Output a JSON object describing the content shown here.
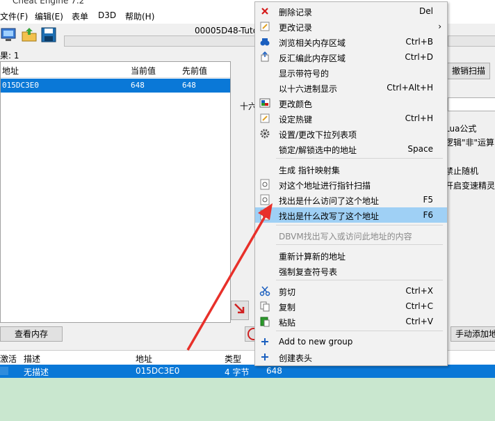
{
  "window": {
    "title": "Cheat Engine 7.2",
    "process": "00005D48-Tuto"
  },
  "menubar": [
    "文件(F)",
    "编辑(E)",
    "表单",
    "D3D",
    "帮助(H)"
  ],
  "scan_panel": {
    "found_label": "果: 1",
    "columns": [
      "地址",
      "当前值",
      "先前值"
    ],
    "rows": [
      {
        "address": "015DC3E0",
        "current": "648",
        "previous": "648"
      }
    ],
    "view_memory_button": "查看内存",
    "undo_scan_button": "撤销扫描",
    "hex_label": "十六",
    "lua_label": "Lua公式",
    "not_logic_label": "逻辑\"非\"运算",
    "no_random_label": "禁止随机",
    "speedhack_label": "开启变速精灵",
    "add_manual_button": "手动添加地"
  },
  "address_table": {
    "columns": [
      "激活",
      "描述",
      "地址",
      "类型",
      "数值"
    ],
    "rows": [
      {
        "active": "",
        "description": "无描述",
        "address": "015DC3E0",
        "type": "4 字节",
        "value": "648"
      }
    ]
  },
  "context_menu": {
    "items": [
      {
        "label": "删除记录",
        "shortcut": "Del",
        "icon": "delete-x-icon"
      },
      {
        "label": "更改记录",
        "shortcut": "",
        "icon": "edit-icon",
        "submenu": "›"
      },
      {
        "label": "浏览相关内存区域",
        "shortcut": "Ctrl+B",
        "icon": "binoculars-icon"
      },
      {
        "label": "反汇编此内存区域",
        "shortcut": "Ctrl+D",
        "icon": "disassemble-icon"
      },
      {
        "label": "显示带符号的",
        "shortcut": "",
        "icon": ""
      },
      {
        "label": "以十六进制显示",
        "shortcut": "Ctrl+Alt+H",
        "icon": ""
      },
      {
        "label": "更改颜色",
        "shortcut": "",
        "icon": "color-icon"
      },
      {
        "label": "设定热键",
        "shortcut": "Ctrl+H",
        "icon": "hotkey-icon"
      },
      {
        "label": "设置/更改下拉列表项",
        "shortcut": "",
        "icon": "gear-icon"
      },
      {
        "label": "锁定/解锁选中的地址",
        "shortcut": "Space",
        "icon": ""
      },
      {
        "label": "生成 指针映射集",
        "shortcut": "",
        "icon": ""
      },
      {
        "label": "对这个地址进行指针扫描",
        "shortcut": "",
        "icon": "pointer-scan-icon"
      },
      {
        "label": "找出是什么访问了这个地址",
        "shortcut": "F5",
        "icon": "find-access-icon"
      },
      {
        "label": "找出是什么改写了这个地址",
        "shortcut": "F6",
        "icon": "find-write-icon"
      },
      {
        "label": "DBVM找出写入或访问此地址的内容",
        "shortcut": "",
        "icon": ""
      },
      {
        "label": "重新计算新的地址",
        "shortcut": "",
        "icon": ""
      },
      {
        "label": "强制复查符号表",
        "shortcut": "",
        "icon": ""
      },
      {
        "label": "剪切",
        "shortcut": "Ctrl+X",
        "icon": "scissors-icon"
      },
      {
        "label": "复制",
        "shortcut": "Ctrl+C",
        "icon": "copy-icon"
      },
      {
        "label": "粘贴",
        "shortcut": "Ctrl+V",
        "icon": "paste-icon"
      },
      {
        "label": "Add to new group",
        "shortcut": "",
        "icon": "plus-icon"
      },
      {
        "label": "创建表头",
        "shortcut": "",
        "icon": "plus-icon"
      }
    ]
  },
  "colors": {
    "selection": "#0a78d7",
    "menu_highlight": "#9fd0f5",
    "annotation_arrow": "#e8302a",
    "bottom_bg": "#c9e7cf"
  }
}
